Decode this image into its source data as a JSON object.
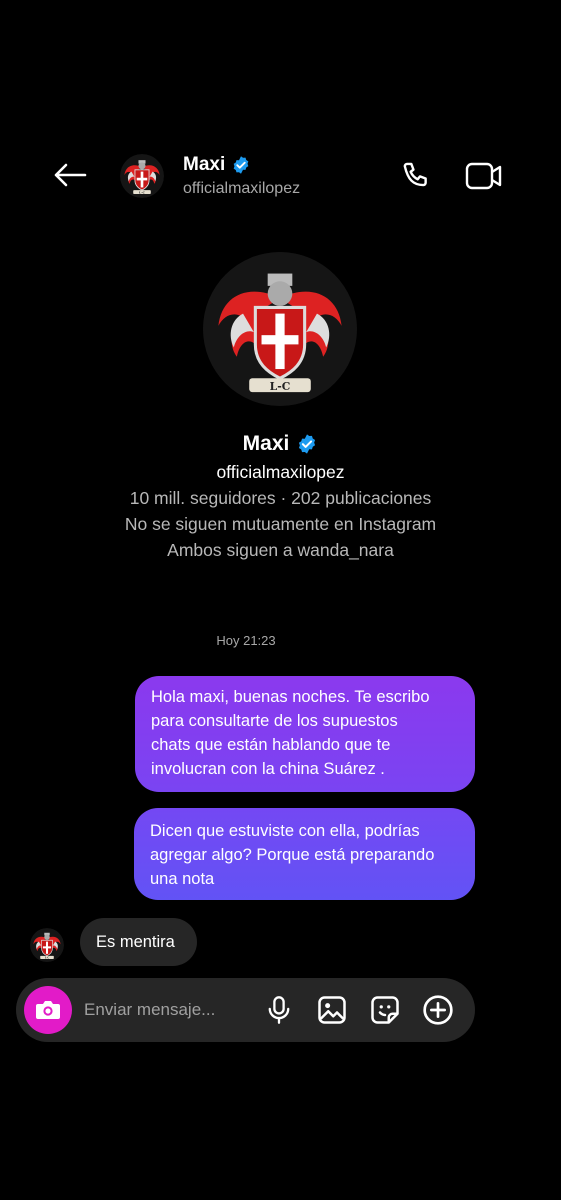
{
  "header": {
    "name": "Maxi",
    "username": "officialmaxilopez",
    "back_icon": "arrow-left-icon",
    "call_icon": "phone-icon",
    "video_icon": "video-camera-icon"
  },
  "profile": {
    "name": "Maxi",
    "username": "officialmaxilopez",
    "stats": "10 mill. seguidores · 202 publicaciones",
    "mutual": "No se siguen mutuamente en Instagram",
    "common_follow": "Ambos siguen a wanda_nara",
    "crest_text": "L-C"
  },
  "chat": {
    "timestamp": "Hoy 21:23",
    "outgoing": [
      {
        "lines": [
          "Hola maxi, buenas noches. Te escribo",
          "para consultarte de los supuestos",
          "chats que están hablando que te",
          "involucran con la china Suárez ."
        ]
      },
      {
        "lines": [
          "Dicen que estuviste con ella, podrías",
          "agregar algo? Porque está preparando",
          "una nota"
        ]
      }
    ],
    "incoming": [
      {
        "text": "Es mentira"
      }
    ]
  },
  "composer": {
    "placeholder": "Enviar mensaje...",
    "icons": [
      "camera-icon",
      "microphone-icon",
      "image-icon",
      "sticker-icon",
      "plus-circle-icon"
    ]
  },
  "colors": {
    "background": "#000000",
    "outgoing_bubble_top": "#8b39ee",
    "outgoing_bubble_bottom": "#6253f5",
    "incoming_bubble": "#262626",
    "camera_button": "#e21bc8",
    "verified": "#1d9bf0"
  }
}
